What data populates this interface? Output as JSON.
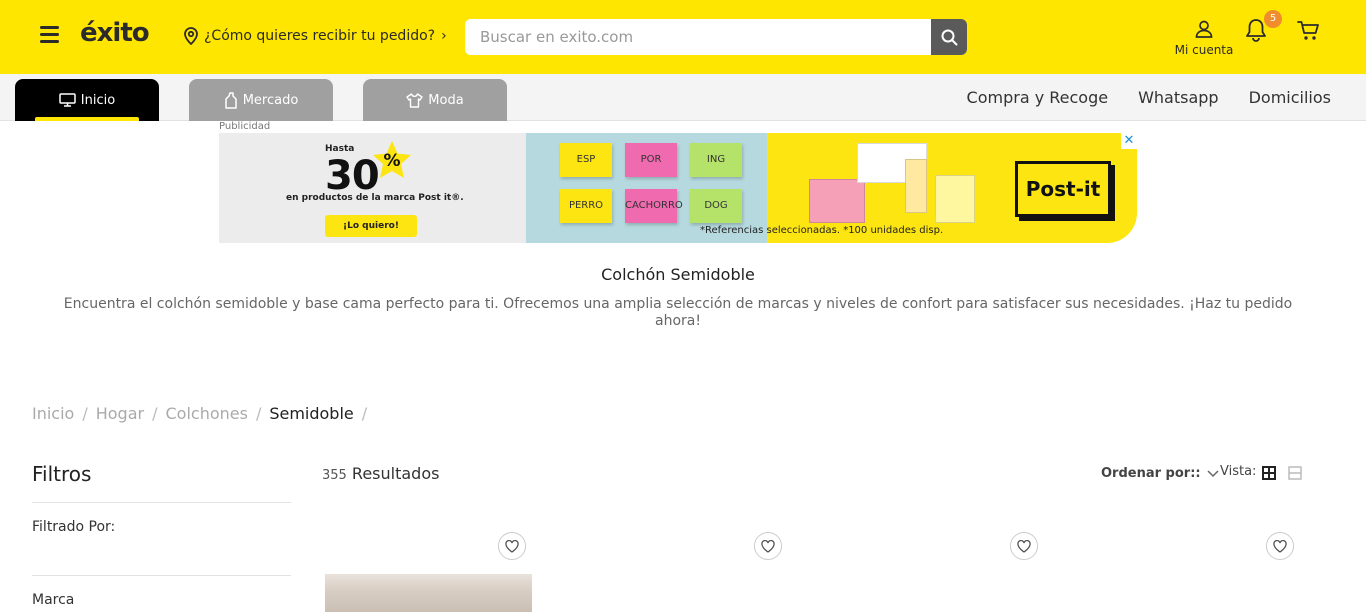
{
  "header": {
    "logo": "éxito",
    "delivery_prompt": "¿Cómo quieres recibir tu pedido?",
    "search_placeholder": "Buscar en exito.com",
    "account_label": "Mi cuenta",
    "notifications_count": "5",
    "background_color": "#ffe600"
  },
  "tabs": [
    {
      "label": "Inicio",
      "icon": "monitor-icon",
      "active": true
    },
    {
      "label": "Mercado",
      "icon": "bottle-icon",
      "active": false
    },
    {
      "label": "Moda",
      "icon": "shirt-icon",
      "active": false
    }
  ],
  "nav_links": [
    "Compra y Recoge",
    "Whatsapp",
    "Domicilios"
  ],
  "ad": {
    "label": "Publicidad",
    "hasta": "Hasta",
    "discount": "30",
    "percent": "%",
    "productos": "en productos de la marca Post it®.",
    "cta": "¡Lo quiero!",
    "notes": [
      "ESP",
      "POR",
      "ING",
      "PERRO",
      "CACHORRO",
      "DOG"
    ],
    "refs": "*Referencias seleccionadas. *100 unidades disp.",
    "brand": "Post-it",
    "close": "✕"
  },
  "category": {
    "title": "Colchón Semidoble",
    "description": "Encuentra el colchón semidoble y base cama perfecto para ti. Ofrecemos una amplia selección de marcas y niveles de confort para satisfacer sus necesidades. ¡Haz tu pedido ahora!"
  },
  "breadcrumb": [
    "Inicio",
    "Hogar",
    "Colchones",
    "Semidoble"
  ],
  "filters": {
    "title": "Filtros",
    "filtrado_por": "Filtrado Por:",
    "marca": "Marca"
  },
  "results": {
    "count": "355",
    "label": "Resultados",
    "sort_label": "Ordenar por::",
    "view_label": "Vista:"
  },
  "products": [
    {
      "favorite_icon": "heart-icon"
    },
    {
      "favorite_icon": "heart-icon"
    },
    {
      "favorite_icon": "heart-icon"
    },
    {
      "favorite_icon": "heart-icon"
    }
  ]
}
